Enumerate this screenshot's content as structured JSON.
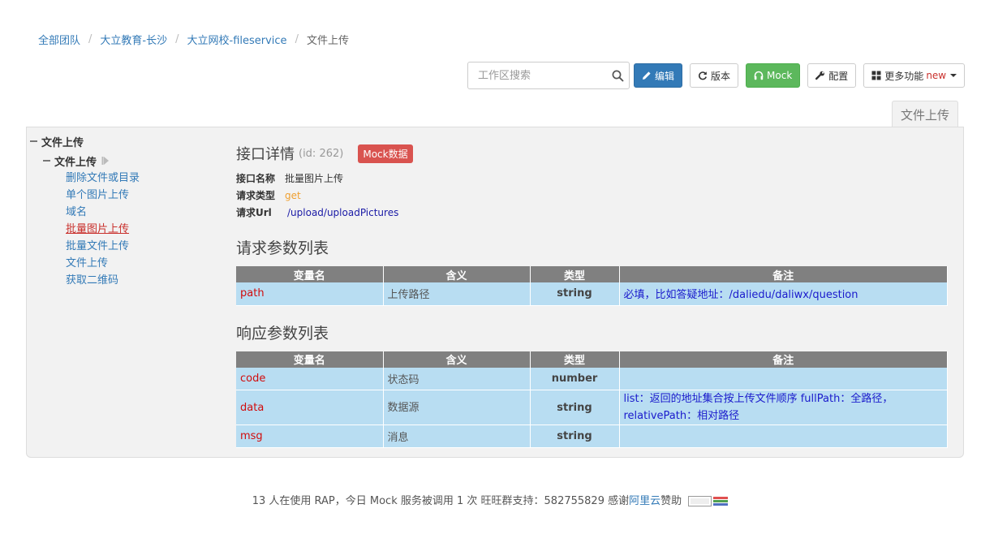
{
  "breadcrumb": {
    "items": [
      "全部团队",
      "大立教育-长沙",
      "大立网校-fileservice"
    ],
    "current": "文件上传",
    "separator": "/"
  },
  "toolbar": {
    "search_placeholder": "工作区搜索",
    "edit_label": "编辑",
    "version_label": "版本",
    "mock_label": "Mock",
    "config_label": "配置",
    "more_label": "更多功能",
    "more_badge": "new"
  },
  "tab": {
    "label": "文件上传"
  },
  "tree": {
    "root_label": "文件上传",
    "sub_label": "文件上传",
    "items": [
      "删除文件或目录",
      "单个图片上传",
      "域名",
      "批量图片上传",
      "批量文件上传",
      "文件上传",
      "获取二维码"
    ],
    "active_index": 3
  },
  "detail": {
    "title": "接口详情",
    "id_text": "(id: 262)",
    "mock_badge": "Mock数据",
    "name_label": "接口名称",
    "name_value": "批量图片上传",
    "type_label": "请求类型",
    "type_value": "get",
    "url_label": "请求Url",
    "url_value": "/upload/uploadPictures"
  },
  "request": {
    "title": "请求参数列表",
    "headers": [
      "变量名",
      "含义",
      "类型",
      "备注"
    ],
    "rows": [
      {
        "name": "path",
        "meaning": "上传路径",
        "type": "string",
        "note": "必填，比如答疑地址：/daliedu/daliwx/question"
      }
    ]
  },
  "response": {
    "title": "响应参数列表",
    "headers": [
      "变量名",
      "含义",
      "类型",
      "备注"
    ],
    "rows": [
      {
        "name": "code",
        "meaning": "状态码",
        "type": "number",
        "note": ""
      },
      {
        "name": "data",
        "meaning": "数据源",
        "type": "string",
        "note": "list：返回的地址集合按上传文件顺序 fullPath：全路径，relativePath：相对路径"
      },
      {
        "name": "msg",
        "meaning": "消息",
        "type": "string",
        "note": ""
      }
    ]
  },
  "footer": {
    "text_prefix": "13 人在使用 RAP，今日 Mock 服务被调用 1 次    旺旺群支持：582755829    感谢",
    "link": "阿里云",
    "text_suffix": "赞助"
  },
  "colors": {
    "primary": "#337ab7",
    "success": "#5cb85c",
    "danger": "#d9534f",
    "table_header": "#808080",
    "table_cell": "#b8ddf2"
  }
}
